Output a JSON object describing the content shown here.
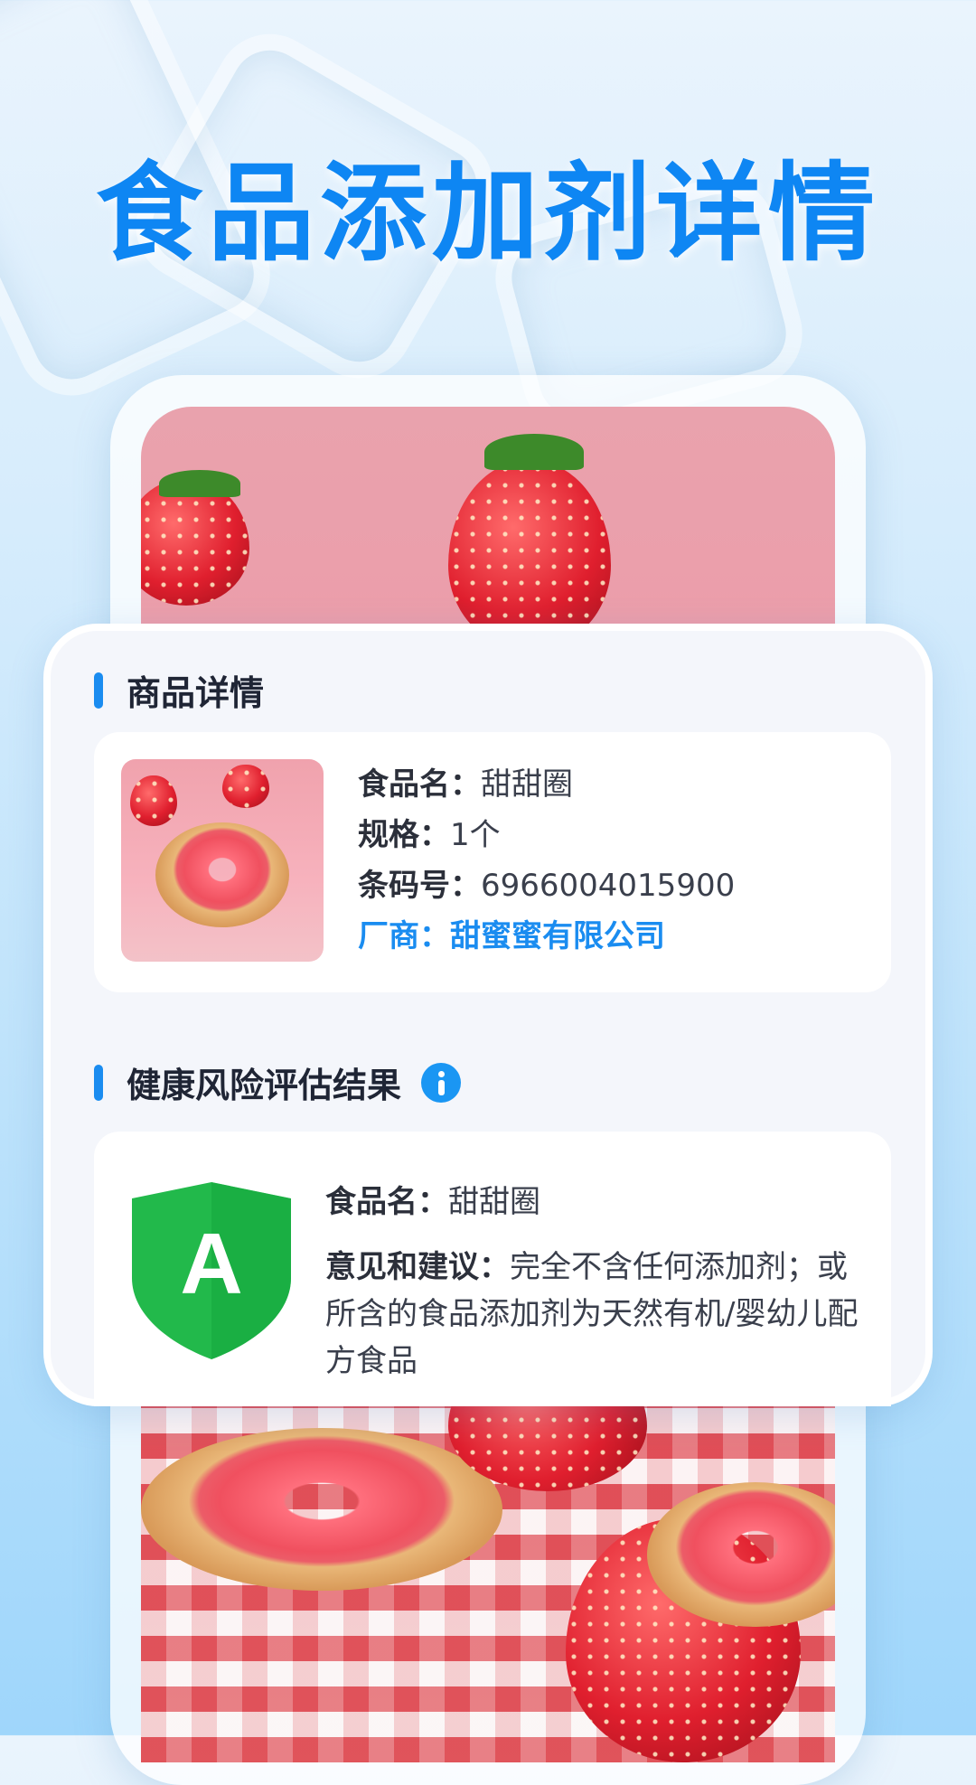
{
  "headline": "食品添加剂详情",
  "product_section": {
    "title": "商品详情",
    "food_name_label": "食品名：",
    "food_name": "甜甜圈",
    "spec_label": "规格：",
    "spec": "1个",
    "barcode_label": "条码号：",
    "barcode": "6966004015900",
    "maker_label": "厂商：",
    "maker": "甜蜜蜜有限公司"
  },
  "risk_section": {
    "title": "健康风险评估结果",
    "info_icon": "info-icon",
    "grade": "A",
    "grade_color": "#22b94b",
    "food_name_label": "食品名：",
    "food_name": "甜甜圈",
    "advice_label": "意见和建议：",
    "advice": "完全不含任何添加剂；或所含的食品添加剂为天然有机/婴幼儿配方食品"
  },
  "colors": {
    "accent": "#1a8cf0",
    "headline": "#0e86f3"
  }
}
